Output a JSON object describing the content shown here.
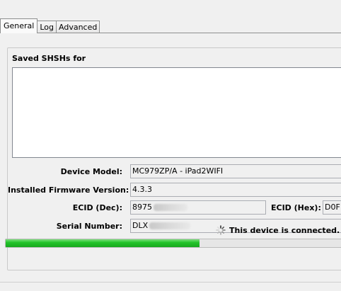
{
  "tabs": [
    {
      "label": "General",
      "active": true
    },
    {
      "label": "Log",
      "active": false
    },
    {
      "label": "Advanced",
      "active": false
    }
  ],
  "general": {
    "group_title": "Saved SHSHs for",
    "device_model_label": "Device Model:",
    "device_model_value": "MC979ZP/A - iPad2WIFI",
    "firmware_label": "Installed Firmware Version:",
    "firmware_value": "4.3.3",
    "ecid_dec_label": "ECID (Dec):",
    "ecid_dec_value": "8975",
    "ecid_hex_label": "ECID (Hex):",
    "ecid_hex_value": "D0F",
    "serial_label": "Serial Number:",
    "serial_value": "DLX",
    "status_text": "This device is connected.",
    "progress_fraction": 0.57
  },
  "colors": {
    "progress": "#23c42a",
    "background": "#f0f0f0"
  }
}
